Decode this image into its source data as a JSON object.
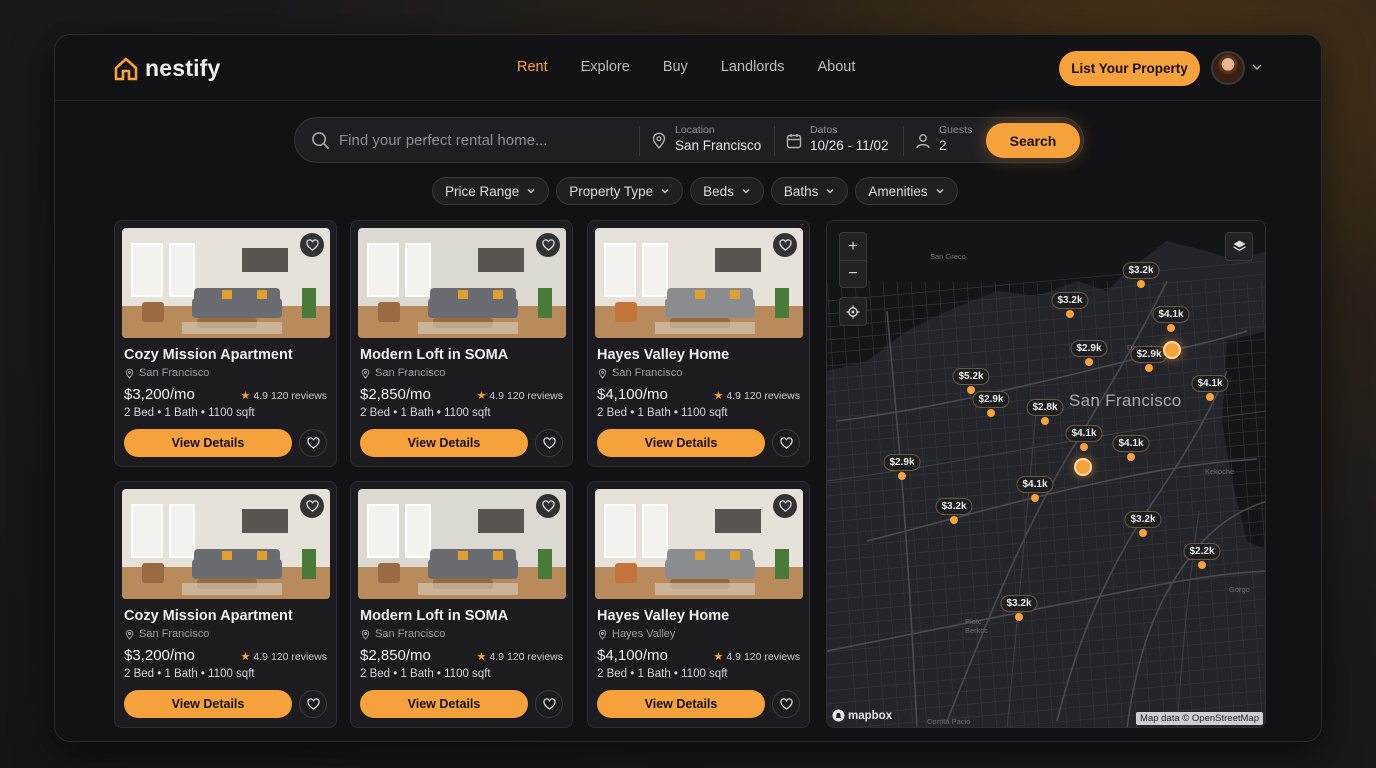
{
  "brand": {
    "name": "nestify"
  },
  "nav": [
    {
      "label": "Rent",
      "active": true
    },
    {
      "label": "Explore",
      "active": false
    },
    {
      "label": "Buy",
      "active": false
    },
    {
      "label": "Landlords",
      "active": false
    },
    {
      "label": "About",
      "active": false
    }
  ],
  "header": {
    "cta_label": "List Your Property"
  },
  "search": {
    "placeholder": "Find your perfect rental home...",
    "location_label": "Location",
    "location_value": "San Francisco",
    "dates_label": "Datos",
    "dates_value": "10/26 - 11/02",
    "guests_label": "Guests",
    "guests_value": "2",
    "button_label": "Search"
  },
  "filters": [
    "Price Range",
    "Property Type",
    "Beds",
    "Baths",
    "Amenities"
  ],
  "listings": [
    {
      "title": "Cozy Mission Apartment",
      "location": "San Francisco",
      "price": "$3,200/mo",
      "rating": "4.9",
      "reviews": "120 reviews",
      "specs": "2 Bed • 1 Bath • 1100 sqft",
      "button": "View Details"
    },
    {
      "title": "Modern Loft in SOMA",
      "location": "San Francisco",
      "price": "$2,850/mo",
      "rating": "4.9",
      "reviews": "120 reviews",
      "specs": "2 Bed • 1 Bath • 1100 sqft",
      "button": "View Details"
    },
    {
      "title": "Hayes Valley Home",
      "location": "San Francisco",
      "price": "$4,100/mo",
      "rating": "4.9",
      "reviews": "120 reviews",
      "specs": "2 Bed • 1 Bath • 1100 sqft",
      "button": "View Details"
    },
    {
      "title": "Cozy Mission Apartment",
      "location": "San Francisco",
      "price": "$3,200/mo",
      "rating": "4.9",
      "reviews": "120 reviews",
      "specs": "2 Bed • 1 Bath • 1100 sqft",
      "button": "View Details"
    },
    {
      "title": "Modern Loft in SOMA",
      "location": "San Francisco",
      "price": "$2,850/mo",
      "rating": "4.9",
      "reviews": "120 reviews",
      "specs": "2 Bed • 1 Bath • 1100 sqft",
      "button": "View Details"
    },
    {
      "title": "Hayes Valley Home",
      "location": "Hayes Valley",
      "price": "$4,100/mo",
      "rating": "4.9",
      "reviews": "120 reviews",
      "specs": "2 Bed • 1 Bath • 1100 sqft",
      "button": "View Details"
    }
  ],
  "map": {
    "city_label": "San Francisco",
    "small_labels": [
      "San Greco",
      "Daoo Hi.",
      "Gorgo",
      "Plotc Berkcc",
      "Corrita Pacio",
      "Kekoche"
    ],
    "pins": [
      "$3.2k",
      "$3.2k",
      "$4.1k",
      "$2.9k",
      "$2.9k",
      "$5.2k",
      "$2.9k",
      "$2.8k",
      "$4.1k",
      "$4.1k",
      "$2.9k",
      "$3.2k",
      "$4.1k",
      "$3.2k",
      "$4.1k",
      "$2.2k",
      "$3.2k"
    ],
    "zoom_in": "+",
    "zoom_out": "−",
    "provider": "mapbox",
    "attribution": "Map data © OpenStreetMap"
  },
  "colors": {
    "accent": "#f6a23c",
    "background": "#121214",
    "card": "#1c1c20"
  }
}
